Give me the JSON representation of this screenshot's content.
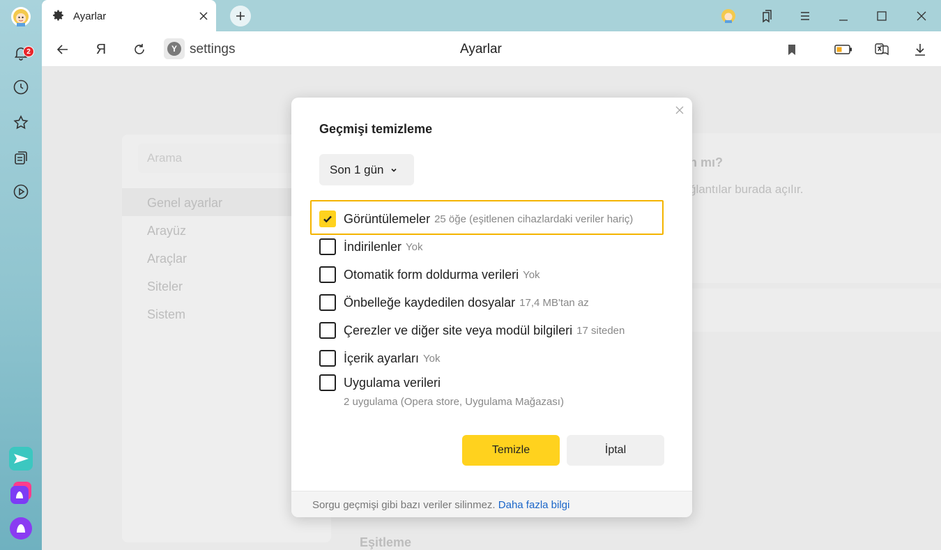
{
  "tab": {
    "title": "Ayarlar"
  },
  "toolbar": {
    "address": "settings",
    "page_title": "Ayarlar",
    "yandex_letter": "Я",
    "y_badge": "Y"
  },
  "sidebar": {
    "notifications_count": "2"
  },
  "settings_nav": {
    "search_placeholder": "Arama",
    "items": [
      "Genel ayarlar",
      "Arayüz",
      "Araçlar",
      "Siteler",
      "Sistem"
    ]
  },
  "background": {
    "partial_heading": "n mı?",
    "partial_text": "ğlantılar burada açılır.",
    "section_heading": "Eşitleme"
  },
  "dialog": {
    "title": "Geçmişi temizleme",
    "period": "Son 1 gün",
    "items": [
      {
        "label": "Görüntülemeler",
        "note": "25 öğe (eşitlenen cihazlardaki veriler hariç)",
        "checked": true
      },
      {
        "label": "İndirilenler",
        "note": "Yok",
        "checked": false
      },
      {
        "label": "Otomatik form doldurma verileri",
        "note": "Yok",
        "checked": false
      },
      {
        "label": "Önbelleğe kaydedilen dosyalar",
        "note": "17,4 MB'tan az",
        "checked": false
      },
      {
        "label": "Çerezler ve diğer site veya modül bilgileri",
        "note": "17 siteden",
        "checked": false
      },
      {
        "label": "İçerik ayarları",
        "note": "Yok",
        "checked": false
      },
      {
        "label": "Uygulama verileri",
        "note": "",
        "checked": false
      }
    ],
    "app_data_note": "2 uygulama (Opera store, Uygulama Mağazası)",
    "clear_button": "Temizle",
    "cancel_button": "İptal",
    "footer_text": "Sorgu geçmişi gibi bazı veriler silinmez.",
    "footer_link": "Daha fazla bilgi"
  },
  "colors": {
    "accent": "#ffd21e",
    "highlight": "#f4b400",
    "link": "#1a66c9",
    "badge": "#e8262b"
  }
}
